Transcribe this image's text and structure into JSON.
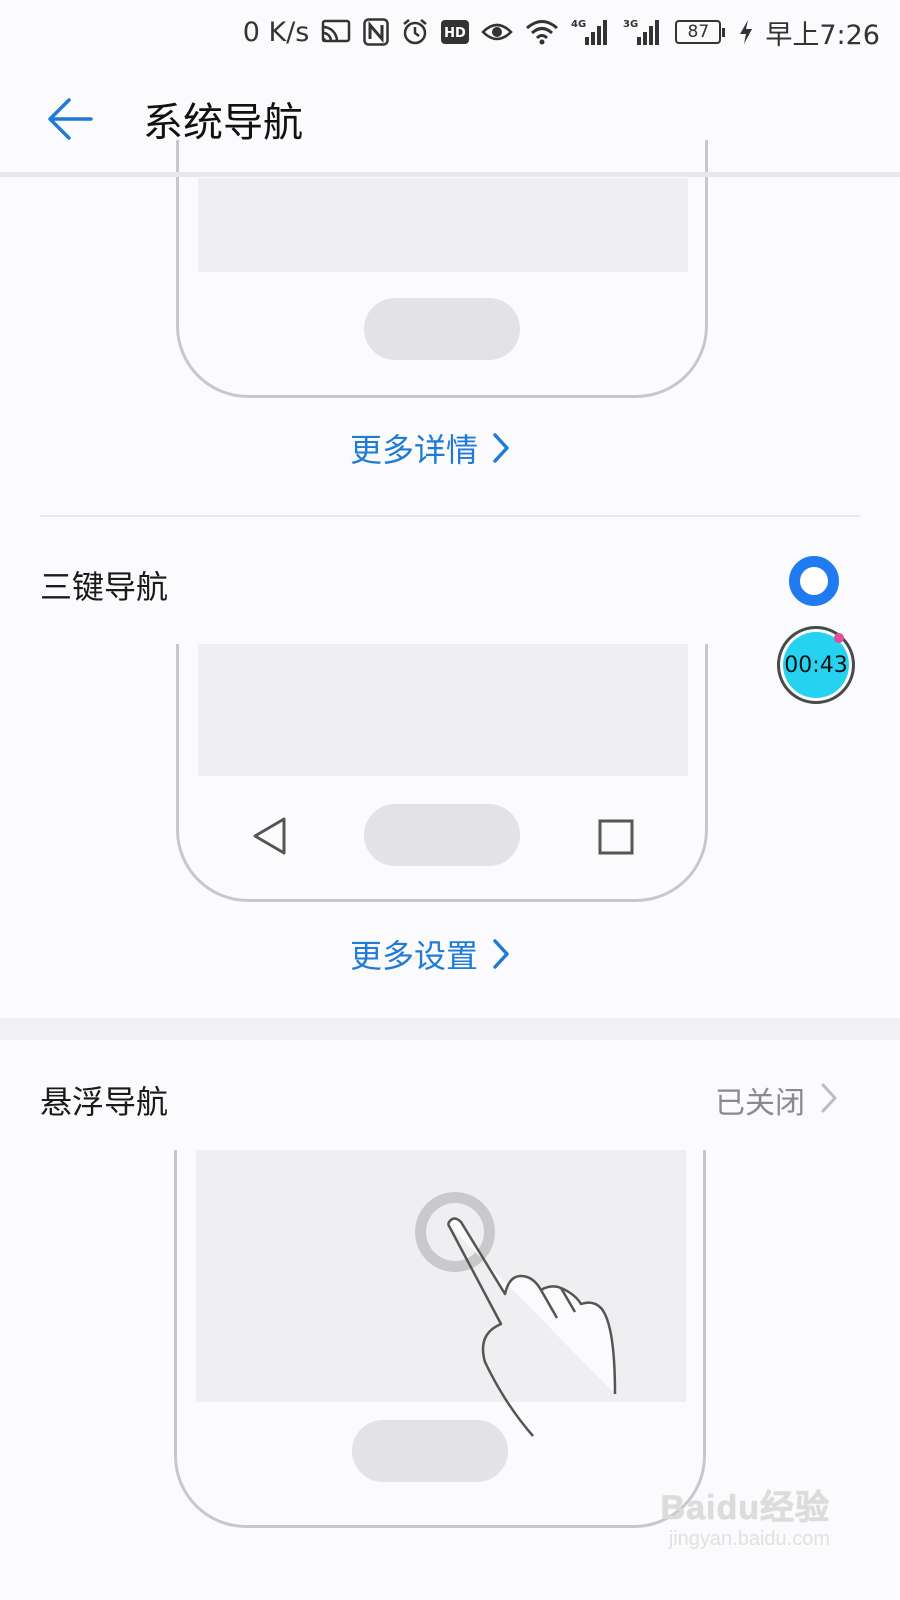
{
  "status_bar": {
    "net_speed": "0 K/s",
    "signal1_label": "4G",
    "signal2_label": "3G",
    "battery_level": "87",
    "time": "早上7:26"
  },
  "header": {
    "title": "系统导航",
    "accent_color": "#1f7bd6"
  },
  "gesture_section": {
    "more_link": "更多详情"
  },
  "three_key_section": {
    "title": "三键导航",
    "selected": true,
    "more_link": "更多设置"
  },
  "overlay_timer": {
    "time": "00:43"
  },
  "floating_section": {
    "title": "悬浮导航",
    "status": "已关闭"
  },
  "watermark": {
    "brand": "Baidu经验",
    "url": "jingyan.baidu.com"
  }
}
